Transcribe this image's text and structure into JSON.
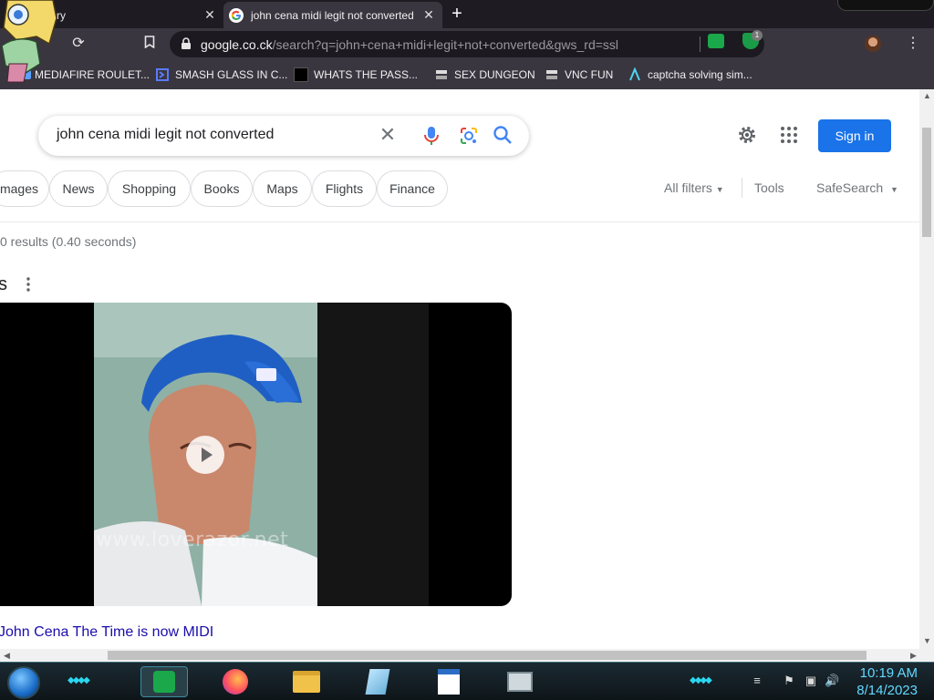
{
  "browser": {
    "tabs": [
      {
        "title": "tory",
        "active": false
      },
      {
        "title": "john cena midi legit not converted",
        "active": true
      }
    ],
    "new_tab_label": "+",
    "close_glyph": "✕",
    "address_bar": {
      "host": "google.co.ck",
      "path": "/search?q=john+cena+midi+legit+not+converted&gws_rd=ssl"
    },
    "extension_badge": "1",
    "bookmarks": [
      {
        "label": "MEDIAFIRE ROULET...",
        "icon": "blue-app-icon"
      },
      {
        "label": "SMASH GLASS IN C...",
        "icon": "chevron-logo-icon"
      },
      {
        "label": "WHATS THE PASS...",
        "icon": "black-square-icon"
      },
      {
        "label": "SEX DUNGEON",
        "icon": "server-icon"
      },
      {
        "label": "VNC FUN",
        "icon": "server-icon"
      },
      {
        "label": "captcha solving sim...",
        "icon": "a-logo-icon"
      }
    ]
  },
  "search": {
    "query": "john cena midi legit not converted",
    "sign_in_label": "Sign in",
    "chips": [
      "mages",
      "News",
      "Shopping",
      "Books",
      "Maps",
      "Flights",
      "Finance"
    ],
    "all_filters_label": "All filters",
    "tools_label": "Tools",
    "safesearch_label": "SafeSearch",
    "result_stats": "0 results (0.40 seconds)",
    "videos_heading": "s",
    "video": {
      "title": "John Cena The Time is now MIDI",
      "watermark": "www.loverazor.net"
    }
  },
  "taskbar": {
    "time": "10:19 AM",
    "date": "8/14/2023",
    "apps": [
      "chat-app-icon",
      "firefox-icon",
      "file-explorer-icon",
      "notepad-icon",
      "wordpad-icon",
      "task-manager-icon"
    ]
  },
  "colors": {
    "accent_blue": "#1a73e8",
    "link": "#1a0dab",
    "chrome_dark": "#3a3640",
    "taskbar_cyan": "#2bd7f0"
  }
}
